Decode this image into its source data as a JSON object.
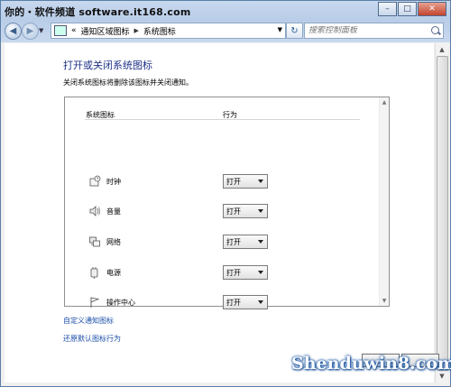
{
  "watermark_top": "你的・软件频道 software.it168.com",
  "watermark_bottom": "Shenduwin8.com",
  "window_controls": [
    "–",
    "□",
    "✕"
  ],
  "nav": {
    "back_icon": "arrow-left-icon",
    "forward_icon": "arrow-right-icon",
    "breadcrumb_prefix": "«",
    "breadcrumb": [
      "通知区域图标",
      "系统图标"
    ],
    "search_placeholder": "搜索控制面板"
  },
  "page": {
    "title": "打开或关闭系统图标",
    "description": "关闭系统图标将删除该图标并关闭通知。"
  },
  "table": {
    "headers": [
      "系统图标",
      "行为"
    ],
    "rows": [
      {
        "label": "时钟",
        "icon": "clock-icon",
        "value": "打开"
      },
      {
        "label": "音量",
        "icon": "volume-icon",
        "value": "打开"
      },
      {
        "label": "网络",
        "icon": "network-icon",
        "value": "打开"
      },
      {
        "label": "电源",
        "icon": "power-icon",
        "value": "打开"
      },
      {
        "label": "操作中心",
        "icon": "flag-icon",
        "value": "打开"
      }
    ]
  },
  "links": {
    "customize": "自定义通知图标",
    "restore": "还原默认图标行为"
  }
}
